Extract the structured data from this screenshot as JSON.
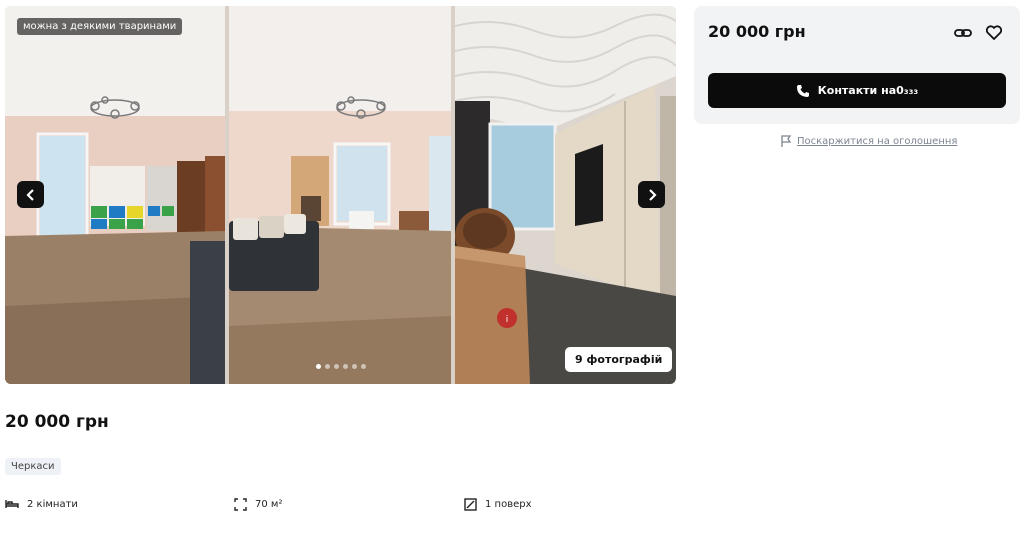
{
  "gallery": {
    "badge": "можна з деякими тваринами",
    "photos_count_label": "9 фотографій",
    "prev_icon": "chevron-left-icon",
    "next_icon": "chevron-right-icon",
    "dots_total": 6,
    "dots_active": 1
  },
  "listing": {
    "price": "20 000 грн",
    "city": "Черкаси",
    "features": [
      {
        "icon": "bed-icon",
        "label": "2 кімнати"
      },
      {
        "icon": "area-icon",
        "label": "70 м²"
      },
      {
        "icon": "floor-icon",
        "label": "1 поверх"
      }
    ]
  },
  "sidebar": {
    "price": "20 000 грн",
    "contact_label": "Контакти на ",
    "contact_phone_masked": "0₃₃₃",
    "report_label": "Поскаржитися на оголошення",
    "icons": [
      "link-icon",
      "heart-icon",
      "phone-icon",
      "flag-icon"
    ]
  },
  "colors": {
    "primary_button": "#0b0b0b",
    "card_bg": "#f2f3f5",
    "muted_text": "#7d8592"
  }
}
